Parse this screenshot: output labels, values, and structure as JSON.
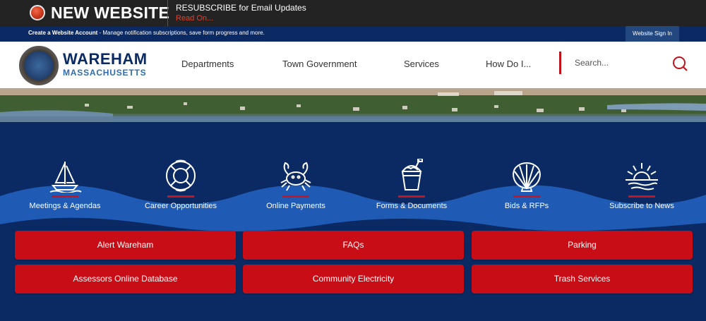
{
  "alert": {
    "title": "NEW WEBSITE",
    "message": "RESUBSCRIBE for Email Updates",
    "link": "Read On..."
  },
  "account": {
    "bold": "Create a Website Account",
    "text": " - Manage notification subscriptions, save form progress and more.",
    "signin": "Website Sign In"
  },
  "logo": {
    "name": "WAREHAM",
    "state": "MASSACHUSETTS"
  },
  "nav": [
    "Departments",
    "Town Government",
    "Services",
    "How Do I..."
  ],
  "search": {
    "placeholder": "Search..."
  },
  "quick_links": [
    {
      "label": "Meetings & Agendas",
      "icon": "sailboat-icon"
    },
    {
      "label": "Career Opportunities",
      "icon": "life-ring-icon"
    },
    {
      "label": "Online Payments",
      "icon": "crab-icon"
    },
    {
      "label": "Forms & Documents",
      "icon": "sand-bucket-icon"
    },
    {
      "label": "Bids & RFPs",
      "icon": "seashell-icon"
    },
    {
      "label": "Subscribe to News",
      "icon": "sunrise-icon"
    }
  ],
  "buttons": [
    "Alert Wareham",
    "FAQs",
    "Parking",
    "Assessors Online Database",
    "Community Electricity",
    "Trash Services"
  ],
  "colors": {
    "navy": "#0b2a63",
    "red": "#c80d16",
    "wave": "#1f5bb5"
  }
}
